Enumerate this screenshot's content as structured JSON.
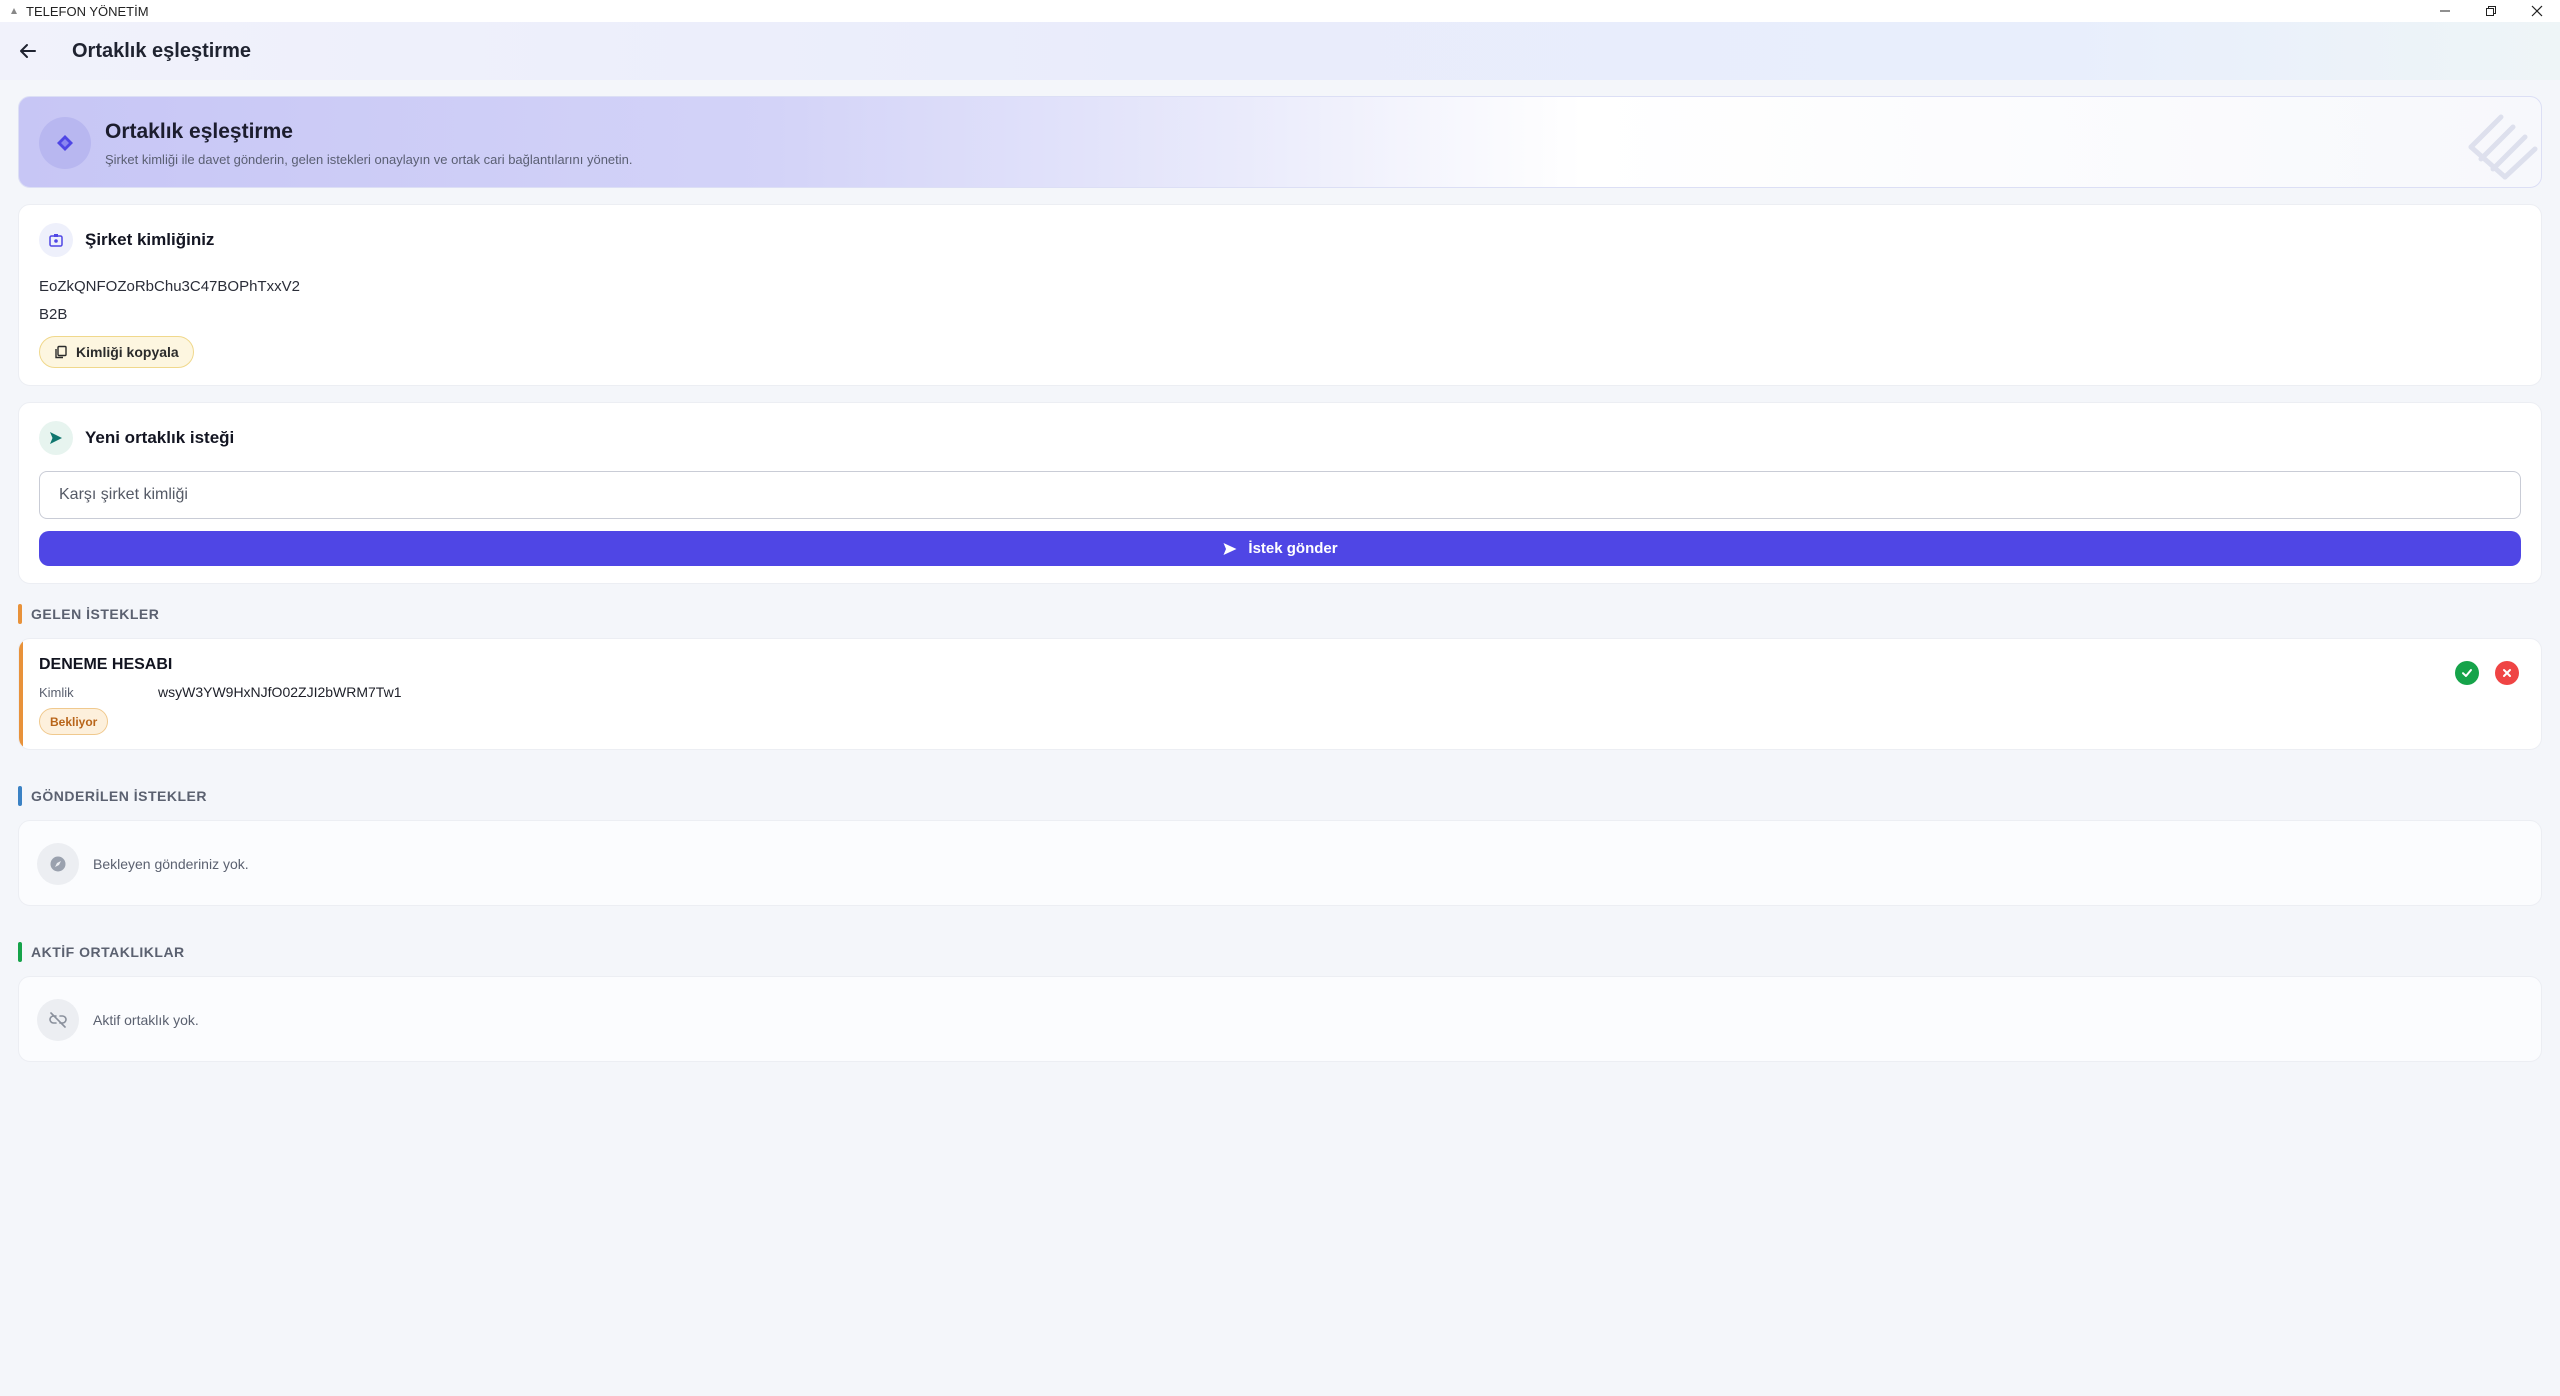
{
  "window": {
    "title": "TELEFON YÖNETİM"
  },
  "appbar": {
    "title": "Ortaklık eşleştirme"
  },
  "hero": {
    "title": "Ortaklık eşleştirme",
    "subtitle": "Şirket kimliği ile davet gönderin, gelen istekleri onaylayın ve ortak cari bağlantılarını yönetin."
  },
  "identity": {
    "title": "Şirket kimliğiniz",
    "company_id": "EoZkQNFOZoRbChu3C47BOPhTxxV2",
    "company_type": "B2B",
    "copy_label": "Kimliği kopyala"
  },
  "new_request": {
    "title": "Yeni ortaklık isteği",
    "input_placeholder": "Karşı şirket kimliği",
    "input_value": "",
    "send_label": "İstek gönder"
  },
  "incoming": {
    "section_label": "GELEN İSTEKLER",
    "accent_color": "#e8923a",
    "items": [
      {
        "company_name": "DENEME HESABI",
        "id_label": "Kimlik",
        "id_value": "wsyW3YW9HxNJfO02ZJI2bWRM7Tw1",
        "status": "Bekliyor"
      }
    ]
  },
  "sent": {
    "section_label": "GÖNDERİLEN İSTEKLER",
    "accent_color": "#3b82c4",
    "empty_text": "Bekleyen gönderiniz yok."
  },
  "active": {
    "section_label": "AKTİF ORTAKLIKLAR",
    "accent_color": "#16a34a",
    "empty_text": "Aktif ortaklık yok."
  },
  "colors": {
    "primary": "#4f46e5",
    "accept": "#16a34a",
    "reject": "#ef4444",
    "pending": "#b8651a"
  },
  "icons": {
    "back": "arrow-left-icon",
    "hero": "handshake-icon",
    "identity": "badge-icon",
    "copy": "copy-icon",
    "send": "send-icon",
    "accept": "check-circle-icon",
    "reject": "close-circle-icon",
    "sent_empty": "compass-icon",
    "active_empty": "link-off-icon"
  }
}
